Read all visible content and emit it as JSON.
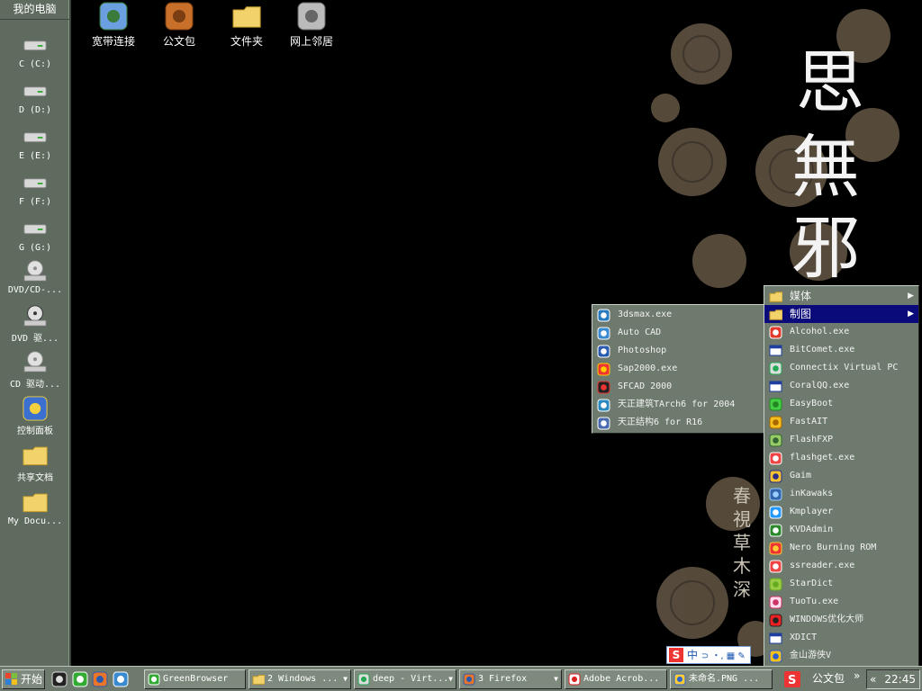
{
  "dock": {
    "title": "我的电脑",
    "items": [
      {
        "label": "C (C:)",
        "icon": "drive-icon"
      },
      {
        "label": "D (D:)",
        "icon": "drive-icon"
      },
      {
        "label": "E (E:)",
        "icon": "drive-icon"
      },
      {
        "label": "F (F:)",
        "icon": "drive-icon"
      },
      {
        "label": "G (G:)",
        "icon": "drive-icon"
      },
      {
        "label": "DVD/CD-...",
        "icon": "cd-drive-icon"
      },
      {
        "label": "DVD 驱...",
        "icon": "dvd-drive-icon"
      },
      {
        "label": "CD 驱动...",
        "icon": "cd-drive-icon"
      },
      {
        "label": "控制面板",
        "icon": "control-panel-icon"
      },
      {
        "label": "共享文档",
        "icon": "folder-icon"
      },
      {
        "label": "My Docu...",
        "icon": "folder-icon"
      }
    ]
  },
  "desktop_icons": [
    {
      "label": "宽带连接",
      "icon": "network-connection-icon"
    },
    {
      "label": "公文包",
      "icon": "briefcase-icon"
    },
    {
      "label": "文件夹",
      "icon": "folder-icon"
    },
    {
      "label": "网上邻居",
      "icon": "network-neighborhood-icon"
    }
  ],
  "main_menu": {
    "items": [
      {
        "label": "媒体",
        "icon": "folder-icon",
        "submenu": true,
        "cn": true
      },
      {
        "label": "制图",
        "icon": "folder-icon",
        "submenu": true,
        "cn": true,
        "selected": true
      },
      {
        "label": "Alcohol.exe",
        "icon": "alcohol-icon"
      },
      {
        "label": "BitComet.exe",
        "icon": "window-icon"
      },
      {
        "label": "Connectix Virtual PC",
        "icon": "virtual-pc-icon"
      },
      {
        "label": "CoralQQ.exe",
        "icon": "window-icon"
      },
      {
        "label": "EasyBoot",
        "icon": "easyboot-icon"
      },
      {
        "label": "FastAIT",
        "icon": "fastait-icon"
      },
      {
        "label": "FlashFXP",
        "icon": "flashfxp-icon"
      },
      {
        "label": "flashget.exe",
        "icon": "flashget-icon"
      },
      {
        "label": "Gaim",
        "icon": "gaim-icon"
      },
      {
        "label": "inKawaks",
        "icon": "inkawaks-icon"
      },
      {
        "label": "Kmplayer",
        "icon": "kmplayer-icon"
      },
      {
        "label": "KVDAdmin",
        "icon": "kvdadmin-icon"
      },
      {
        "label": "Nero Burning ROM",
        "icon": "nero-icon"
      },
      {
        "label": "ssreader.exe",
        "icon": "ssreader-icon"
      },
      {
        "label": "StarDict",
        "icon": "stardict-icon"
      },
      {
        "label": "TuoTu.exe",
        "icon": "tuotu-icon"
      },
      {
        "label": "WINDOWS优化大师",
        "icon": "windows-master-icon"
      },
      {
        "label": "XDICT",
        "icon": "window-icon"
      },
      {
        "label": "金山游侠V",
        "icon": "kingsoft-icon"
      }
    ]
  },
  "sub_menu": {
    "items": [
      {
        "label": "3dsmax.exe",
        "icon": "3dsmax-icon"
      },
      {
        "label": "Auto CAD",
        "icon": "autocad-icon"
      },
      {
        "label": "Photoshop",
        "icon": "photoshop-icon"
      },
      {
        "label": "Sap2000.exe",
        "icon": "sap2000-icon"
      },
      {
        "label": "SFCAD 2000",
        "icon": "sfcad-icon"
      },
      {
        "label": "天正建筑TArch6 for 2004",
        "icon": "tarch-icon"
      },
      {
        "label": "天正结构6 for R16",
        "icon": "tstruct-icon"
      }
    ]
  },
  "ime": {
    "label": "中",
    "symbols": "⊃ ・, ▦ ✎"
  },
  "taskbar": {
    "start_label": "开始",
    "quick_launch": [
      "alien-icon",
      "greenbrowser-icon",
      "firefox-icon",
      "ie-icon"
    ],
    "tasks": [
      {
        "label": "GreenBrowser",
        "icon": "greenbrowser-icon"
      },
      {
        "label": "2 Windows ...",
        "icon": "folder-icon",
        "group": true
      },
      {
        "label": "deep - Virt...",
        "icon": "virtual-pc-icon",
        "group": true
      },
      {
        "label": "3 Firefox",
        "icon": "firefox-icon",
        "group": true
      },
      {
        "label": "Adobe Acrob...",
        "icon": "acrobat-icon"
      },
      {
        "label": "未命名.PNG ...",
        "icon": "paint-icon"
      }
    ],
    "tray_toolbar_label": "公文包",
    "tray_arrows": "»",
    "tray_collapse": "«",
    "clock": "22:45"
  },
  "colors": {
    "chrome": "#6d7a6d",
    "selection": "#0a0a7a",
    "wallpaper": "#000000",
    "flower": "#5e5344"
  }
}
